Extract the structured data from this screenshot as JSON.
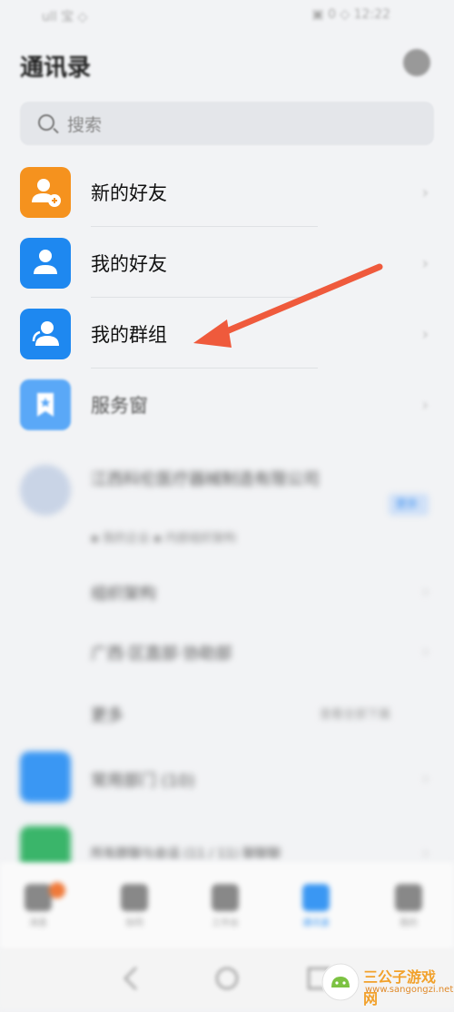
{
  "status_bar": {
    "left": "ull 宝 ◇",
    "right": "▣ 0 ◇ 12:22"
  },
  "header": {
    "title": "通讯录"
  },
  "search": {
    "placeholder": "搜索"
  },
  "contacts_list": [
    {
      "label": "新的好友",
      "icon": "add-friend-icon",
      "color": "#f5921e"
    },
    {
      "label": "我的好友",
      "icon": "person-icon",
      "color": "#1e88f0"
    },
    {
      "label": "我的群组",
      "icon": "group-icon",
      "color": "#1e88f0"
    },
    {
      "label": "服务窗",
      "icon": "bookmark-star-icon",
      "color": "#5aa8f7"
    }
  ],
  "organization": {
    "name": "江西科伦医疗器械制造有限公司",
    "tag": "更多",
    "sub": "▪ 我的企业   ▪ 内部组织架构",
    "items": [
      "组织架构",
      "广西·区直部·协助部",
      "更多"
    ],
    "item_right": "查看全部下属",
    "departments": [
      "常用部门 (10)",
      "所有群聊与会话 (11 / 11) 聊聊聊"
    ]
  },
  "tabbar": {
    "tabs": [
      {
        "label": "消息",
        "icon": "chat-icon"
      },
      {
        "label": "协同",
        "icon": "home-icon"
      },
      {
        "label": "工作台",
        "icon": "grid-icon"
      },
      {
        "label": "通讯录",
        "icon": "contacts-icon"
      },
      {
        "label": "我的",
        "icon": "profile-icon"
      }
    ]
  },
  "watermark": {
    "title": "三公子游戏网",
    "url": "www.sangongzi.net"
  },
  "colors": {
    "annotation_arrow": "#ef5a3c",
    "accent": "#1e88f0"
  }
}
